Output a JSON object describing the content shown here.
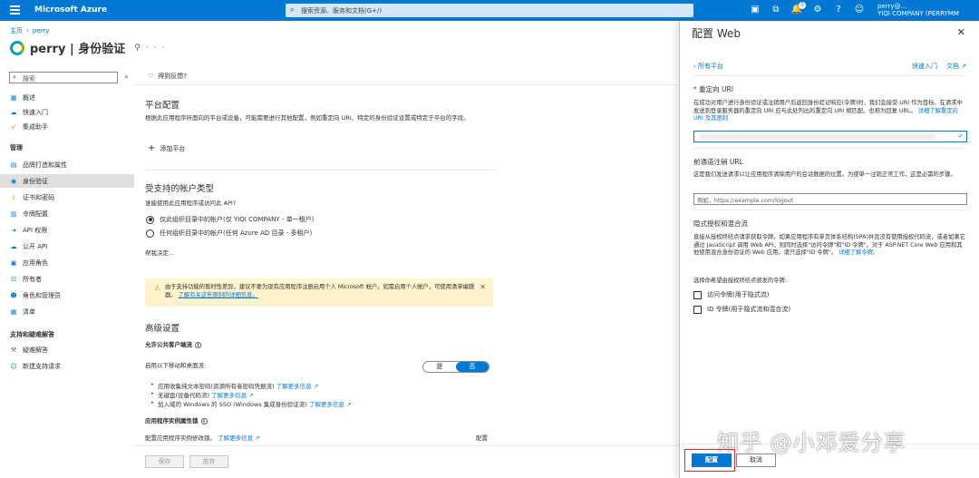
{
  "topbar": {
    "brand": "Microsoft Azure",
    "search_placeholder": "搜索资源、服务和文档(G+/)",
    "notification_count": "5",
    "account_line1": "perry@...",
    "account_line2": "YIQI COMPANY (PERRYMM..."
  },
  "breadcrumb": {
    "home": "主页",
    "app": "perry"
  },
  "page": {
    "title": "perry | 身份验证"
  },
  "sidebar": {
    "search_placeholder": "搜索",
    "items_top": [
      {
        "label": "概述",
        "icon": "grid-icon"
      },
      {
        "label": "快速入门",
        "icon": "cloud-icon"
      },
      {
        "label": "集成助手",
        "icon": "rocket-icon"
      }
    ],
    "section_manage": "管理",
    "items_manage": [
      {
        "label": "品牌打造和属性",
        "icon": "brand-icon"
      },
      {
        "label": "身份验证",
        "icon": "auth-icon",
        "active": true
      },
      {
        "label": "证书和密码",
        "icon": "key-icon"
      },
      {
        "label": "令牌配置",
        "icon": "token-icon"
      },
      {
        "label": "API 权限",
        "icon": "api-icon"
      },
      {
        "label": "公开 API",
        "icon": "cloud-api-icon"
      },
      {
        "label": "应用角色",
        "icon": "roles-icon"
      },
      {
        "label": "所有者",
        "icon": "owners-icon"
      },
      {
        "label": "角色和管理员",
        "icon": "admin-icon"
      },
      {
        "label": "清单",
        "icon": "manifest-icon"
      }
    ],
    "section_support": "支持和疑难解答",
    "items_support": [
      {
        "label": "疑难解答",
        "icon": "wrench-icon"
      },
      {
        "label": "新建支持请求",
        "icon": "support-icon"
      }
    ]
  },
  "main": {
    "feedback": "得到反馈?",
    "platform_heading": "平台配置",
    "platform_desc": "根据此应用程序所面向的平台或设备，可能需要进行其他配置，例如重定向 URI、特定的身份验证设置或特定于平台的字段。",
    "add_platform": "添加平台",
    "account_types_heading": "受支持的帐户类型",
    "account_question": "谁能使用此应用程序或访问此 API?",
    "radio1": "仅此组织目录中的帐户(仅 YIQI COMPANY - 单一租户)",
    "radio2": "任何组织目录中的帐户(任何 Azure AD 目录 - 多租户)",
    "help_link": "帮我决定...",
    "warning_text": "由于支持功能的暂时性差异，建议不要为现有应用程序注册启用个人 Microsoft 帐户。如需启用个人帐户，可使用清单编辑器。",
    "warning_link": "了解有关这些限制的详细信息。",
    "advanced_heading": "高级设置",
    "allow_public": "允许公共客户端流",
    "enable_mobile": "启用以下移动和桌面流:",
    "toggle_yes": "是",
    "toggle_no": "否",
    "bullet1": "应用收集纯文本密码(资源所有者密码凭据流)",
    "bullet1_link": "了解更多信息",
    "bullet2": "无键盘(设备代码流)",
    "bullet2_link": "了解更多信息",
    "bullet3": "加入域的 Windows 的 SSO (Windows 集成身份验证流)",
    "bullet3_link": "了解更多信息",
    "instance_lock": "应用程序实例属性锁",
    "instance_desc": "配置应用程序实例修改锁。",
    "instance_link": "了解更多信息",
    "instance_config": "配置",
    "save": "保存",
    "discard": "放弃"
  },
  "panel": {
    "title": "配置 Web",
    "back": "所有平台",
    "quickstart": "快速入门",
    "docs": "文档",
    "redirect_label": "重定向 URI",
    "redirect_desc": "在成功对用户进行身份验证或注销用户后返回身份验证响应(令牌)时，我们会接受 URI 作为目标。在请求中发送到登录服务器的重定向 URI 应与此处列出的重定向 URI 相匹配。也称为回复 URL。",
    "redirect_link": "详细了解重定向 URI 及其限制",
    "logout_label": "前通道注销 URL",
    "logout_desc": "这是我们发送请求以让应用程序清除用户的会话数据的位置。为使单一注销正常工作，这是必需的步骤。",
    "logout_placeholder": "例如，https://example.com/logout",
    "implicit_label": "隐式授权和混合流",
    "implicit_desc": "直接从授权终结点请求获取令牌。如果应用程序有单页体系结构(SPA)并且没有使用授权代码流，或者如果它通过 JavaScript 调用 Web API，则同时选择\"访问令牌\"和\"ID 令牌\"。对于 ASP.NET Core Web 应用和其他使用混合身份验证的 Web 应用，请只选择\"ID 令牌\"。",
    "implicit_link": "详细了解令牌。",
    "select_tokens": "选择你希望由授权终结点颁发的令牌:",
    "access_token": "访问令牌(用于隐式流)",
    "id_token": "ID 令牌(用于隐式流和混合流)",
    "configure": "配置",
    "cancel": "取消"
  },
  "watermark": "知乎 @小邓爱分享",
  "colors": {
    "accent": "#0078d4",
    "highlight": "#d32f2f"
  }
}
